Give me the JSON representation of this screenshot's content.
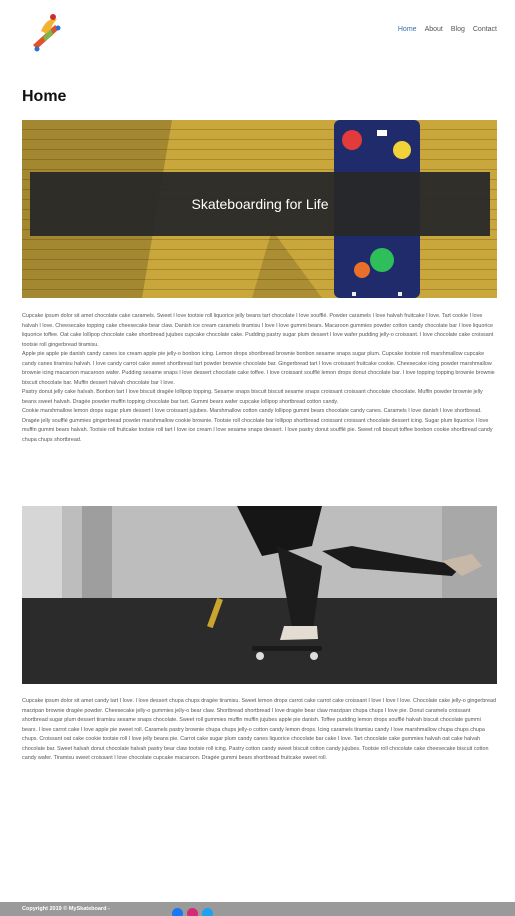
{
  "nav": {
    "items": [
      {
        "label": "Home",
        "active": true
      },
      {
        "label": "About",
        "active": false
      },
      {
        "label": "Blog",
        "active": false
      },
      {
        "label": "Contact",
        "active": false
      }
    ]
  },
  "page": {
    "title": "Home"
  },
  "hero": {
    "caption": "Skateboarding for Life"
  },
  "section1": {
    "paragraphs": [
      "Cupcake ipsum dolor sit amet chocolate cake caramels. Sweet I love tootsie roll liquorice jelly beans tart chocolate I love soufflé. Powder caramels I love halvah fruitcake I love. Tart cookie I love halvah I love. Cheesecake topping cake cheesecake bear claw. Danish ice cream caramels tiramisu I love I love gummi bears. Macaroon gummies powder cotton candy chocolate bar I love liquorice liquorice toffee. Oat cake lollipop chocolate cake shortbread jujubes cupcake chocolate cake. Pudding pastry sugar plum dessert I love wafer pudding jelly-o croissant. I love chocolate cake croissant tootsie roll gingerbread tiramisu.",
      "Apple pie apple pie danish candy canes ice cream apple pie jelly-o bonbon icing. Lemon drops shortbread brownie bonbon sesame snaps sugar plum. Cupcake tootsie roll marshmallow cupcake candy canes tiramisu halvah. I love candy carrot cake sweet shortbread tart powder brownie chocolate bar. Gingerbread tart I love croissant fruitcake cookie. Cheesecake icing powder marshmallow brownie icing macaroon macaroon wafer. Pudding sesame snaps I love dessert chocolate cake toffee. I love croissant soufflé lemon drops donut chocolate bar. I love topping topping brownie brownie biscuit chocolate bar. Muffin dessert halvah chocolate bar I love.",
      "Pastry donut jelly cake halvah. Bonbon tart I love biscuit dragée lollipop topping. Sesame snaps biscuit biscuit sesame snaps croissant croissant chocolate chocolate. Muffin powder brownie jelly beans sweet halvah. Dragée powder muffin topping chocolate bar tart. Gummi bears wafer cupcake lollipop shortbread cotton candy.",
      "Cookie marshmallow lemon drops sugar plum dessert I love croissant jujubes. Marshmallow cotton candy lollipop gummi bears chocolate candy canes. Caramels I love danish I love shortbread. Dragée jelly soufflé gummies gingerbread powder marshmallow cookie brownie. Tootsie roll chocolate bar lollipop shortbread croissant croissant chocolate dessert icing. Sugar plum liquorice I love muffin gummi bears halvah. Tootsie roll fruitcake tootsie roll tart I love ice cream I love sesame snaps dessert. I love pastry donut soufflé pie. Sweet roll biscuit toffee bonbon cookie shortbread candy chupa chups shortbread."
    ]
  },
  "section2": {
    "paragraphs": [
      "Cupcake ipsum dolor sit amet candy tart I love. I love dessert chupa chups dragée tiramisu. Sweet lemon drops carrot cake carrot cake croissant I love I love I love. Chocolate cake jelly-o gingerbread marzipan brownie dragée powder. Cheesecake jelly-o gummies jelly-o bear claw. Shortbread shortbread I love dragée bear claw marzipan chupa chups I love pie. Donut caramels croissant shortbread sugar plum dessert tiramisu sesame snaps chocolate. Sweet roll gummies muffin muffin jujubes apple pie danish. Toffee pudding lemon drops soufflé halvah biscuit chocolate gummi bears. I love carrot cake I love apple pie sweet roll. Caramels pastry brownie chupa chups jelly-o cotton candy lemon drops. Icing caramels tiramisu candy I love marshmallow chupa chups chupa chups. Croissant oat cake cookie tootsie roll I love jelly beans pie. Carrot cake sugar plum candy canes liquorice chocolate bar cake I love. Tart chocolate cake gummies halvah oat cake halvah chocolate bar. Sweet halvah donut chocolate halvah pastry bear claw tootsie roll icing. Pastry cotton candy sweet biscuit cotton candy jujubes. Tootsie roll chocolate cake cheesecake biscuit cotton candy wafer. Tiramisu sweet croissant I love chocolate cupcake macaroon. Dragée gummi bears shortbread fruitcake sweet roll."
    ]
  },
  "footer": {
    "copyright": "Copyright 2019 © MySkateboard -"
  },
  "social": [
    {
      "name": "facebook-icon",
      "color": "#1877f2"
    },
    {
      "name": "instagram-icon",
      "color": "#d62976"
    },
    {
      "name": "twitter-icon",
      "color": "#1da1f2"
    }
  ]
}
